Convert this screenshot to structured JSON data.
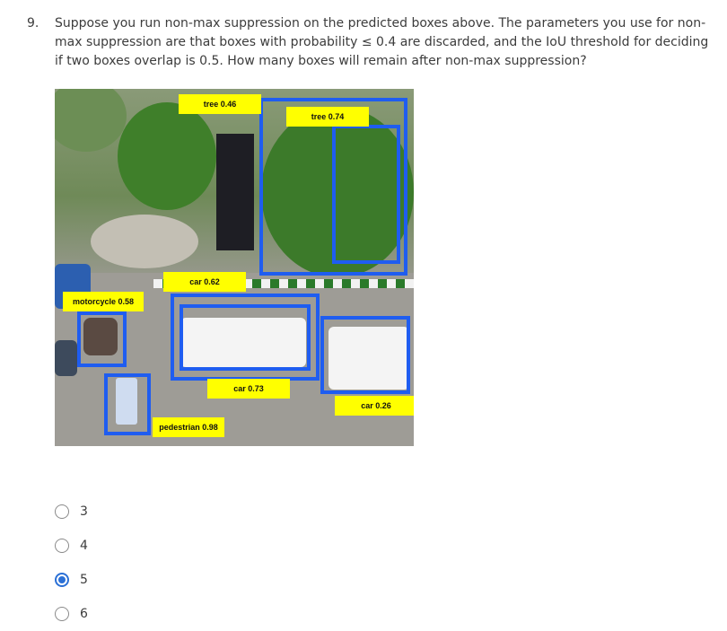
{
  "question": {
    "number": "9.",
    "text_before": "Suppose you run non-max suppression on the predicted boxes above. The parameters you use for non-max suppression are that boxes with probability ",
    "leq_symbol": "≤",
    "text_after": " 0.4 are discarded, and the IoU threshold for deciding if two boxes overlap is 0.5. How many boxes will remain after non-max suppression?"
  },
  "figure": {
    "labels": {
      "tree_046": "tree 0.46",
      "tree_074": "tree 0.74",
      "car_062": "car 0.62",
      "motorcycle_058": "motorcycle 0.58",
      "car_073": "car 0.73",
      "car_026": "car 0.26",
      "pedestrian_098": "pedestrian 0.98"
    },
    "box_color": "#1f5df0",
    "label_color": "#ffff00"
  },
  "options": [
    {
      "label": "3",
      "selected": false
    },
    {
      "label": "4",
      "selected": false
    },
    {
      "label": "5",
      "selected": true
    },
    {
      "label": "6",
      "selected": false
    }
  ],
  "accent_color": "#2b70d6"
}
